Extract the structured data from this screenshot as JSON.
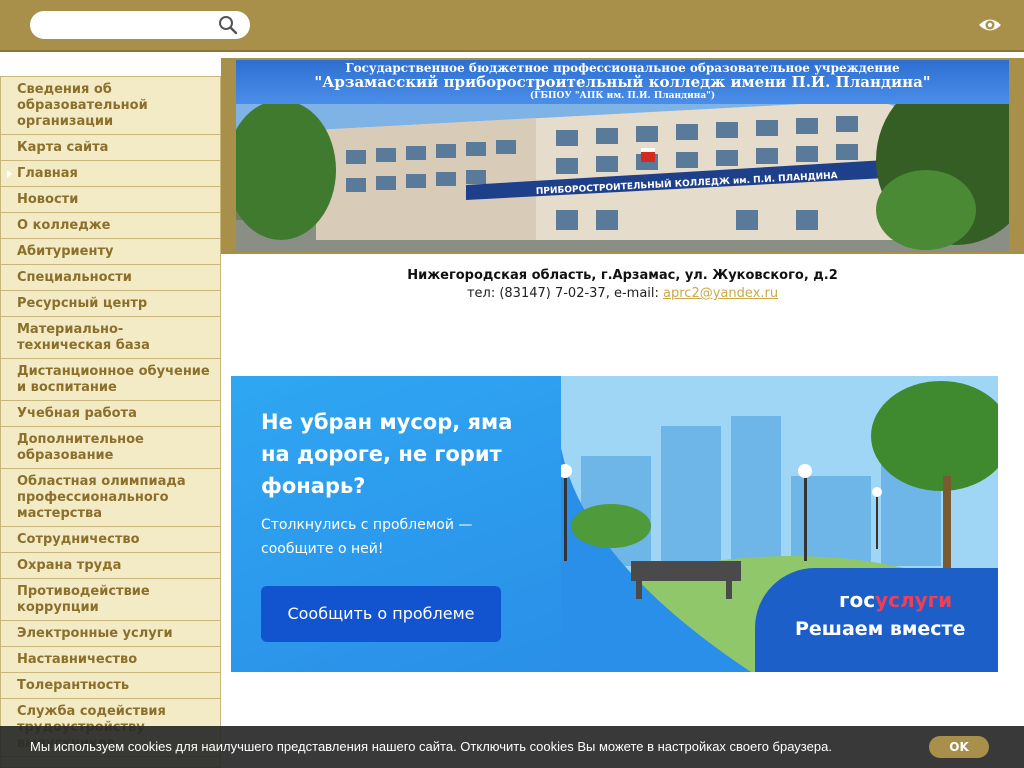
{
  "search": {
    "placeholder": ""
  },
  "sidebar": {
    "items": [
      {
        "label": "Сведения об образовательной организации"
      },
      {
        "label": "Карта сайта"
      },
      {
        "label": "Главная"
      },
      {
        "label": "Новости"
      },
      {
        "label": "О колледже"
      },
      {
        "label": "Абитуриенту"
      },
      {
        "label": "Специальности"
      },
      {
        "label": "Ресурсный центр"
      },
      {
        "label": "Материально-техническая база"
      },
      {
        "label": "Дистанционное обучение и воспитание"
      },
      {
        "label": "Учебная работа"
      },
      {
        "label": "Дополнительное образование"
      },
      {
        "label": "Областная олимпиада профессионального мастерства"
      },
      {
        "label": "Сотрудничество"
      },
      {
        "label": "Охрана труда"
      },
      {
        "label": "Противодействие коррупции"
      },
      {
        "label": "Электронные услуги"
      },
      {
        "label": "Наставничество"
      },
      {
        "label": "Толерантность"
      },
      {
        "label": "Служба содействия трудоустройству выпускников"
      }
    ]
  },
  "banner": {
    "line1": "Государственное бюджетное профессиональное образовательное учреждение",
    "line2": "\"Арзамасский приборостроительный колледж имени П.И. Пландина\"",
    "line3": "(ГБПОУ \"АПК им. П.И. Пландина\")",
    "building_sign": "ПРИБОРОСТРОИТЕЛЬНЫЙ КОЛЛЕДЖ им. П.И. ПЛАНДИНА"
  },
  "address": {
    "line1": "Нижегородская область, г.Арзамас, ул. Жуковского, д.2",
    "phone": "тел: (83147) 7-02-37, e-mail: ",
    "email": "aprc2@yandex.ru"
  },
  "gosuslugi": {
    "heading": "Не убран мусор, яма на дороге, не горит фонарь?",
    "sub": "Столкнулись с проблемой — сообщите о ней!",
    "button": "Сообщить о проблеме",
    "logo_a": "гос",
    "logo_b": "услуги",
    "motto": "Решаем вместе"
  },
  "cookie": {
    "text": "Мы используем cookies для наилучшего представления нашего сайта. Отключить cookies Вы можете в настройках своего браузера.",
    "ok": "OK"
  },
  "colors": {
    "topbar": "#a8904a",
    "sidebar_bg": "#f3ebc6",
    "sidebar_text": "#8b6f2a",
    "gos_blue": "#2d9ef0",
    "gos_button": "#1253d0"
  }
}
